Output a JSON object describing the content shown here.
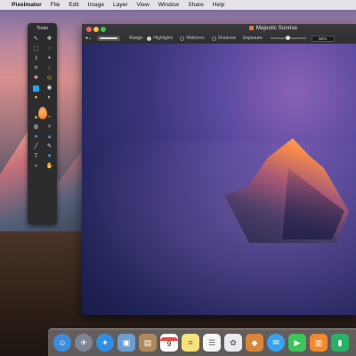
{
  "menubar": {
    "apple_glyph": "",
    "app_name": "Pixelmator",
    "items": [
      "File",
      "Edit",
      "Image",
      "Layer",
      "View",
      "Window",
      "Share",
      "Help"
    ]
  },
  "tools_palette": {
    "title": "Tools",
    "tools": [
      "move",
      "arrange",
      "rect-select",
      "ellipse-select",
      "lasso",
      "magic-wand",
      "crop",
      "eyedropper",
      "repair",
      "clone",
      "brush",
      "pencil",
      "eraser",
      "fill",
      "color-picker",
      "gradient",
      "smudge",
      "sharpen",
      "sponge",
      "burn",
      "red-eye",
      "light-balance",
      "drop",
      "burn-dodge",
      "pen",
      "shape",
      "type",
      "heart-shape",
      "zoom",
      "other"
    ]
  },
  "window": {
    "title": "Majestic Sunrise",
    "options_bar": {
      "range_label": "Range:",
      "range_options": [
        "Highlights",
        "Midtones",
        "Shadows"
      ],
      "selected_range": "Highlights",
      "exposure_label": "Exposure:",
      "exposure_value": "50%",
      "exposure_level": 0.5
    }
  },
  "dock": {
    "apps": [
      {
        "name": "finder",
        "color": "#3b8de0"
      },
      {
        "name": "launchpad",
        "color": "#7d8794"
      },
      {
        "name": "safari",
        "color": "#2f8fe5"
      },
      {
        "name": "preview",
        "color": "#6c9fd0"
      },
      {
        "name": "contacts",
        "color": "#b08a5c"
      },
      {
        "name": "calendar",
        "color": "#fafafa",
        "label": "9"
      },
      {
        "name": "notes",
        "color": "#f6e27a"
      },
      {
        "name": "reminders",
        "color": "#f4f4f4"
      },
      {
        "name": "photos",
        "color": "#e9e9ef"
      },
      {
        "name": "pixelmator",
        "color": "#d8863a"
      },
      {
        "name": "messages",
        "color": "#37a3f0"
      },
      {
        "name": "facetime",
        "color": "#3fc35d"
      },
      {
        "name": "ibooks",
        "color": "#f08a2e"
      },
      {
        "name": "numbers",
        "color": "#2ab067"
      }
    ]
  }
}
